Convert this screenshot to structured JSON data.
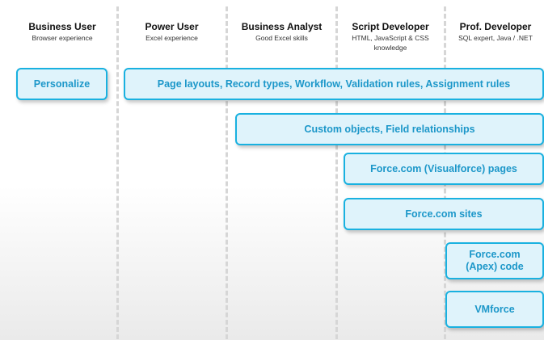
{
  "columns": [
    {
      "title": "Business User",
      "subtitle": "Browser experience"
    },
    {
      "title": "Power User",
      "subtitle": "Excel experience"
    },
    {
      "title": "Business Analyst",
      "subtitle": "Good Excel skills"
    },
    {
      "title": "Script Developer",
      "subtitle": "HTML, JavaScript & CSS knowledge"
    },
    {
      "title": "Prof. Developer",
      "subtitle": "SQL expert, Java / .NET"
    }
  ],
  "boxes": {
    "personalize": "Personalize",
    "declarative": "Page layouts, Record types, Workflow, Validation rules, Assignment rules",
    "custom_objects": "Custom objects, Field relationships",
    "visualforce": "Force.com (Visualforce) pages",
    "sites": "Force.com sites",
    "apex_line1": "Force.com",
    "apex_line2": "(Apex) code",
    "vmforce": "VMforce"
  },
  "colors": {
    "box_border": "#19b1e0",
    "box_fill": "#dff3fb",
    "box_text": "#1c97c9"
  }
}
